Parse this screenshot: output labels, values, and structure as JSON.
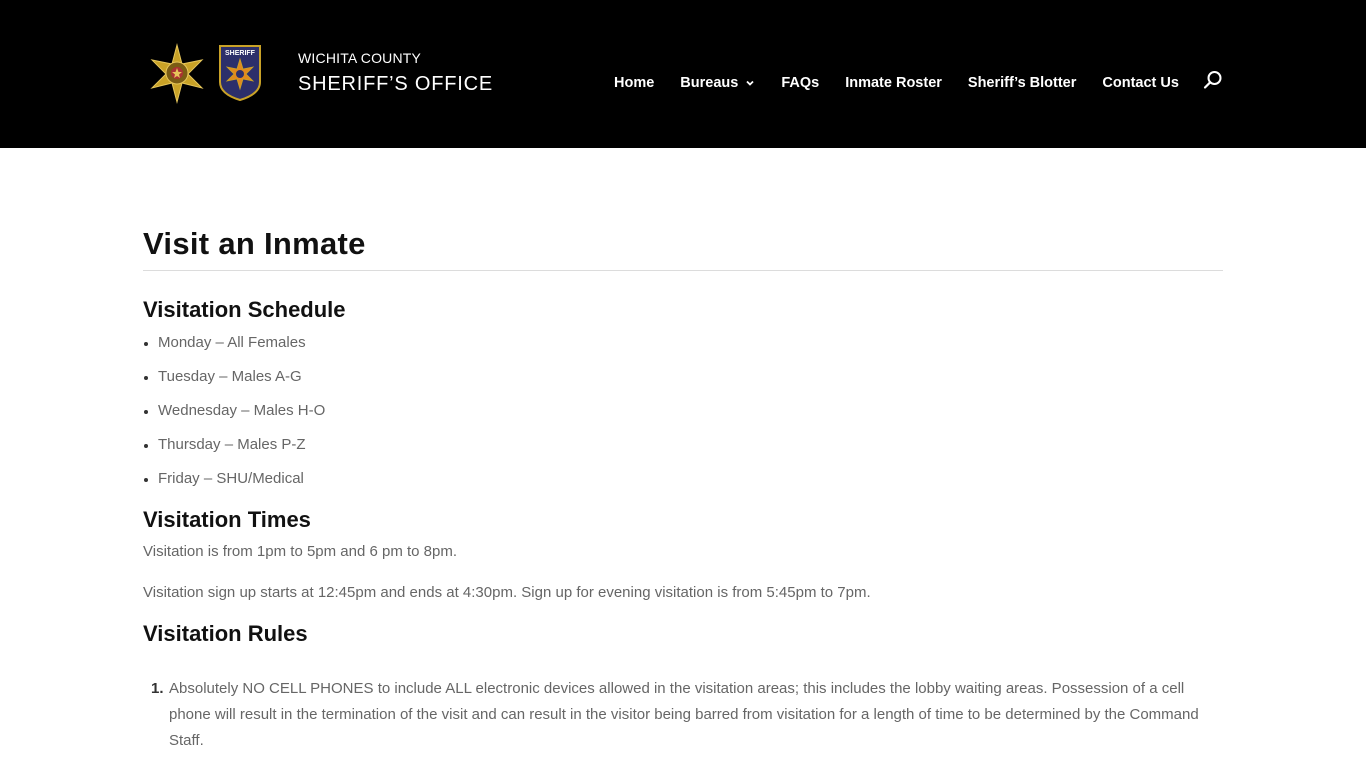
{
  "header": {
    "brand_line1": "WICHITA COUNTY",
    "brand_line2": "SHERIFF’S OFFICE",
    "badge_patch_text": "SHERIFF",
    "colors": {
      "background": "#000000",
      "text": "#ffffff",
      "badge_gold": "#c9a227",
      "patch_navy": "#2c2f6b"
    }
  },
  "nav": {
    "items": [
      {
        "label": "Home"
      },
      {
        "label": "Bureaus",
        "icon": "chevron-down-icon"
      },
      {
        "label": "FAQs"
      },
      {
        "label": "Inmate Roster"
      },
      {
        "label": "Sheriff’s Blotter"
      },
      {
        "label": "Contact Us"
      }
    ],
    "search_icon": "search-icon"
  },
  "page": {
    "title": "Visit an Inmate",
    "schedule": {
      "heading": "Visitation Schedule",
      "items": [
        "Monday – All Females",
        "Tuesday – Males A-G",
        "Wednesday – Males H-O",
        "Thursday – Males P-Z",
        "Friday – SHU/Medical"
      ]
    },
    "times": {
      "heading": "Visitation Times",
      "para1": "Visitation is from 1pm to 5pm and 6 pm to 8pm.",
      "para2": "Visitation sign up starts at 12:45pm and ends at 4:30pm. Sign up for evening visitation is from 5:45pm to 7pm."
    },
    "rules": {
      "heading": "Visitation Rules",
      "items": [
        {
          "number": "1.",
          "text": "Absolutely NO CELL PHONES to include ALL electronic devices allowed in the visitation areas; this includes the lobby waiting areas. Possession of a cell phone will result in the termination of the visit and can result in the visitor being barred from visitation for a length of time to be determined by the Command Staff."
        }
      ]
    }
  }
}
